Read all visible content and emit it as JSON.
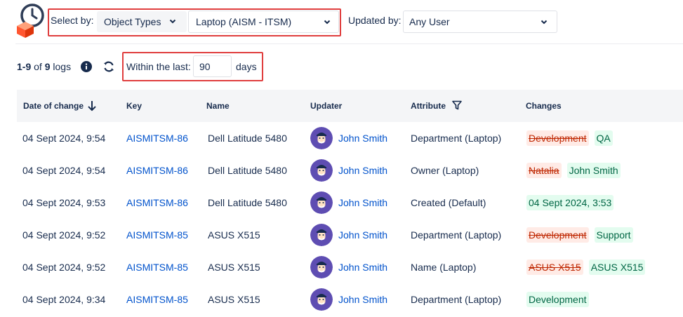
{
  "toolbar": {
    "select_by_label": "Select by:",
    "select_type_value": "Object Types",
    "select_object_value": "Laptop (AISM - ITSM)",
    "updated_by_label": "Updated by:",
    "updated_by_value": "Any User",
    "icons": [
      "clock-icon",
      "box-icon",
      "chevron-down-icon"
    ]
  },
  "summary": {
    "range": "1-9",
    "of_text": "of",
    "total": "9",
    "logs_text": "logs",
    "within_label": "Within the last:",
    "days_value": "90",
    "days_label": "days"
  },
  "table": {
    "columns": [
      "Date of change",
      "Key",
      "Name",
      "Updater",
      "Attribute",
      "Changes"
    ],
    "rows": [
      {
        "date": "04 Sept 2024, 9:54",
        "key": "AISMITSM-86",
        "name": "Dell Latitude 5480",
        "updater": "John Smith",
        "attribute": "Department (Laptop)",
        "old": "Development",
        "new": "QA"
      },
      {
        "date": "04 Sept 2024, 9:54",
        "key": "AISMITSM-86",
        "name": "Dell Latitude 5480",
        "updater": "John Smith",
        "attribute": "Owner (Laptop)",
        "old": "Natalia",
        "new": "John Smith"
      },
      {
        "date": "04 Sept 2024, 9:53",
        "key": "AISMITSM-86",
        "name": "Dell Latitude 5480",
        "updater": "John Smith",
        "attribute": "Created (Default)",
        "old": "",
        "new": "04 Sept 2024, 3:53"
      },
      {
        "date": "04 Sept 2024, 9:52",
        "key": "AISMITSM-85",
        "name": "ASUS X515",
        "updater": "John Smith",
        "attribute": "Department (Laptop)",
        "old": "Development",
        "new": "Support"
      },
      {
        "date": "04 Sept 2024, 9:52",
        "key": "AISMITSM-85",
        "name": "ASUS X515",
        "updater": "John Smith",
        "attribute": "Name (Laptop)",
        "old": "ASUS X515",
        "new": "ASUS X515"
      },
      {
        "date": "04 Sept 2024, 9:34",
        "key": "AISMITSM-85",
        "name": "ASUS X515",
        "updater": "John Smith",
        "attribute": "Department (Laptop)",
        "old": "",
        "new": "Development"
      }
    ]
  },
  "colors": {
    "link": "#0052cc",
    "highlight_border": "#e03e3e",
    "removed_bg": "#ffebe6",
    "added_bg": "#e3fcef",
    "avatar_bg": "#5e4db2"
  }
}
